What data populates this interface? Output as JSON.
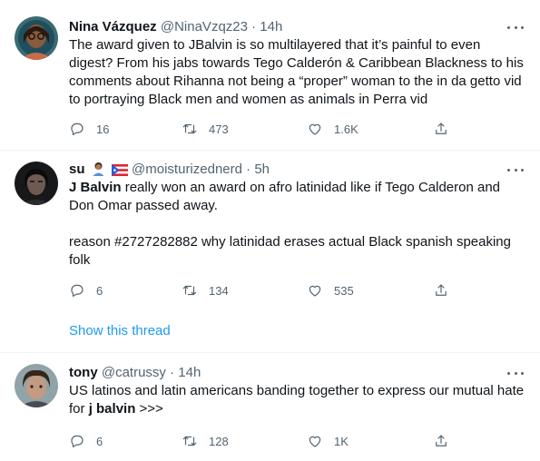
{
  "tweets": [
    {
      "name": "Nina Vázquez",
      "handle": "@NinaVzqz23",
      "time": "· 14h",
      "text": "The award given to JBalvin is so multilayered that it’s painful to even digest? From his jabs towards Tego Calderón & Caribbean Blackness to his comments about Rihanna not being a “proper” woman to the in da getto vid to portraying Black men and women as animals in Perra vid",
      "reply_count": "16",
      "retweet_count": "473",
      "like_count": "1.6K"
    },
    {
      "name": "su",
      "handle": "@moisturizednerd",
      "time": "· 5h",
      "text_bold": "J Balvin",
      "text_rest": " really won an award on afro latinidad like if Tego Calderon and Don Omar passed away.",
      "text_para2": "reason #2727282882 why latinidad erases actual Black spanish speaking folk",
      "reply_count": "6",
      "retweet_count": "134",
      "like_count": "535",
      "show_thread": "Show this thread"
    },
    {
      "name": "tony",
      "handle": "@catrussy",
      "time": "· 14h",
      "text_start": "US latinos and latin americans banding together to express our mutual hate for ",
      "text_bold": "j balvin",
      "text_end": " >>>",
      "reply_count": "6",
      "retweet_count": "128",
      "like_count": "1K"
    }
  ],
  "colors": {
    "text_primary": "#0f1419",
    "text_secondary": "#536471",
    "link": "#1d9bf0",
    "divider": "#eff3f4"
  },
  "icons": [
    "reply-icon",
    "retweet-icon",
    "like-icon",
    "share-icon",
    "more-icon"
  ]
}
